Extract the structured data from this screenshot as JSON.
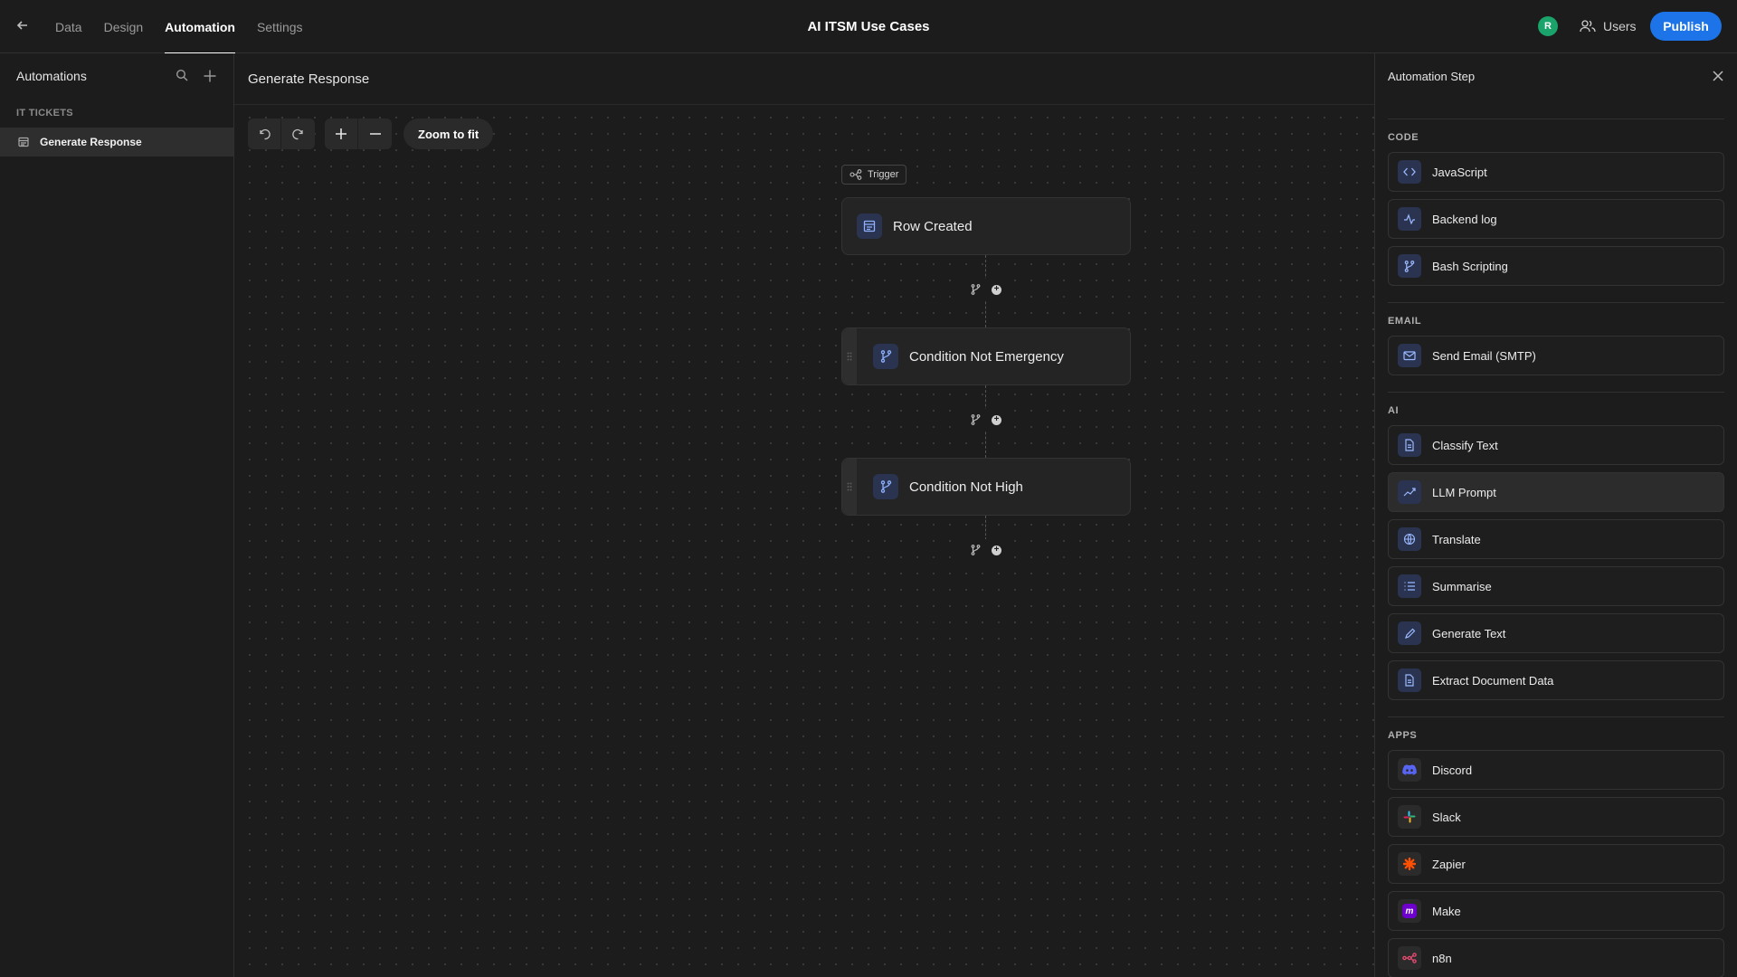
{
  "colors": {
    "accent": "#1d74e8",
    "avatar": "#1aa36a",
    "background": "#1c1c1c"
  },
  "topbar": {
    "tabs": [
      {
        "label": "Data",
        "active": false
      },
      {
        "label": "Design",
        "active": false
      },
      {
        "label": "Automation",
        "active": true
      },
      {
        "label": "Settings",
        "active": false
      }
    ],
    "title": "AI ITSM Use Cases",
    "avatar_initial": "R",
    "users_label": "Users",
    "publish_label": "Publish"
  },
  "sidebar": {
    "title": "Automations",
    "group_label": "IT TICKETS",
    "items": [
      {
        "label": "Generate Response",
        "icon": "table-icon",
        "selected": true
      }
    ]
  },
  "canvas": {
    "title": "Generate Response",
    "zoom_fit_label": "Zoom to fit",
    "trigger_label": "Trigger",
    "nodes": [
      {
        "label": "Row Created",
        "icon": "table-icon"
      },
      {
        "label": "Condition Not Emergency",
        "icon": "branch-icon"
      },
      {
        "label": "Condition Not High",
        "icon": "branch-icon"
      }
    ]
  },
  "panel": {
    "title": "Automation Step",
    "sections": [
      {
        "label": "CODE",
        "steps": [
          {
            "label": "JavaScript",
            "icon": "code-icon"
          },
          {
            "label": "Backend log",
            "icon": "pulse-icon"
          },
          {
            "label": "Bash Scripting",
            "icon": "branch-icon"
          }
        ]
      },
      {
        "label": "EMAIL",
        "steps": [
          {
            "label": "Send Email (SMTP)",
            "icon": "mail-icon"
          }
        ]
      },
      {
        "label": "AI",
        "steps": [
          {
            "label": "Classify Text",
            "icon": "document-icon"
          },
          {
            "label": "LLM Prompt",
            "icon": "trend-icon"
          },
          {
            "label": "Translate",
            "icon": "globe-icon"
          },
          {
            "label": "Summarise",
            "icon": "list-icon"
          },
          {
            "label": "Generate Text",
            "icon": "pencil-icon"
          },
          {
            "label": "Extract Document Data",
            "icon": "document-icon"
          }
        ]
      },
      {
        "label": "APPS",
        "steps": [
          {
            "label": "Discord",
            "icon": "discord-icon"
          },
          {
            "label": "Slack",
            "icon": "slack-icon"
          },
          {
            "label": "Zapier",
            "icon": "zapier-icon"
          },
          {
            "label": "Make",
            "icon": "make-icon"
          },
          {
            "label": "n8n",
            "icon": "n8n-icon"
          }
        ]
      }
    ]
  }
}
